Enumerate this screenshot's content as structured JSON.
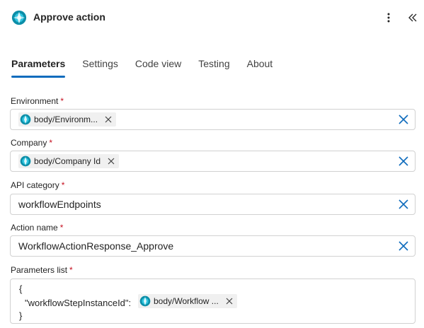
{
  "header": {
    "title": "Approve action",
    "app_icon": "dataverse-icon",
    "more_icon": "more-vertical-icon",
    "collapse_icon": "double-chevron-left-icon"
  },
  "tabs": [
    {
      "label": "Parameters",
      "active": true
    },
    {
      "label": "Settings",
      "active": false
    },
    {
      "label": "Code view",
      "active": false
    },
    {
      "label": "Testing",
      "active": false
    },
    {
      "label": "About",
      "active": false
    }
  ],
  "fields": {
    "environment": {
      "label": "Environment",
      "required": "*",
      "token": "body/Environm..."
    },
    "company": {
      "label": "Company",
      "required": "*",
      "token": "body/Company Id"
    },
    "api_category": {
      "label": "API category",
      "required": "*",
      "value": "workflowEndpoints"
    },
    "action_name": {
      "label": "Action name",
      "required": "*",
      "value": "WorkflowActionResponse_Approve"
    },
    "parameters_list": {
      "label": "Parameters list",
      "required": "*",
      "open_brace": "{",
      "key": "\"workflowStepInstanceId\":",
      "token": "body/Workflow ...",
      "close_brace": "}"
    }
  },
  "colors": {
    "accent": "#0f6cbd",
    "required": "#c50f1f",
    "token_bg": "#f0f0f0"
  }
}
